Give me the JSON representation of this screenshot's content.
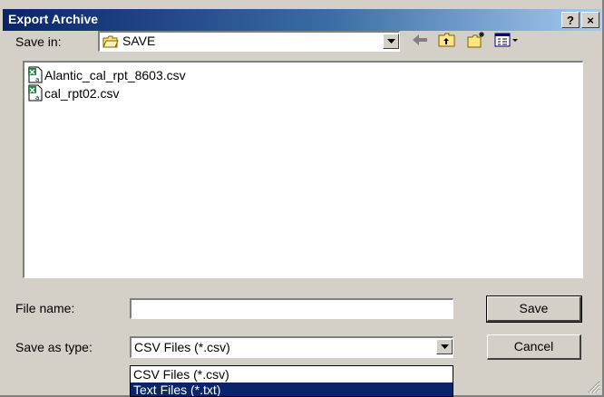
{
  "window": {
    "title": "Export Archive",
    "help_label": "?",
    "close_label": "×"
  },
  "save_in": {
    "label": "Save in:",
    "value": "SAVE"
  },
  "toolbar": [
    "back-arrow-icon",
    "up-folder-icon",
    "new-folder-icon",
    "view-menu-icon"
  ],
  "files": [
    {
      "name": "Alantic_cal_rpt_8603.csv",
      "icon": "csv-file-icon"
    },
    {
      "name": "cal_rpt02.csv",
      "icon": "csv-file-icon"
    }
  ],
  "file_name": {
    "label": "File name:",
    "value": ""
  },
  "save_as_type": {
    "label": "Save as type:",
    "value": "CSV Files (*.csv)",
    "options": [
      "CSV Files (*.csv)",
      "Text Files (*.txt)"
    ],
    "highlighted_option": "Text Files (*.txt)"
  },
  "buttons": {
    "save": "Save",
    "cancel": "Cancel"
  },
  "colors": {
    "title_active": "#0a246a",
    "face": "#d4d0c8",
    "highlight": "#0a246a"
  }
}
